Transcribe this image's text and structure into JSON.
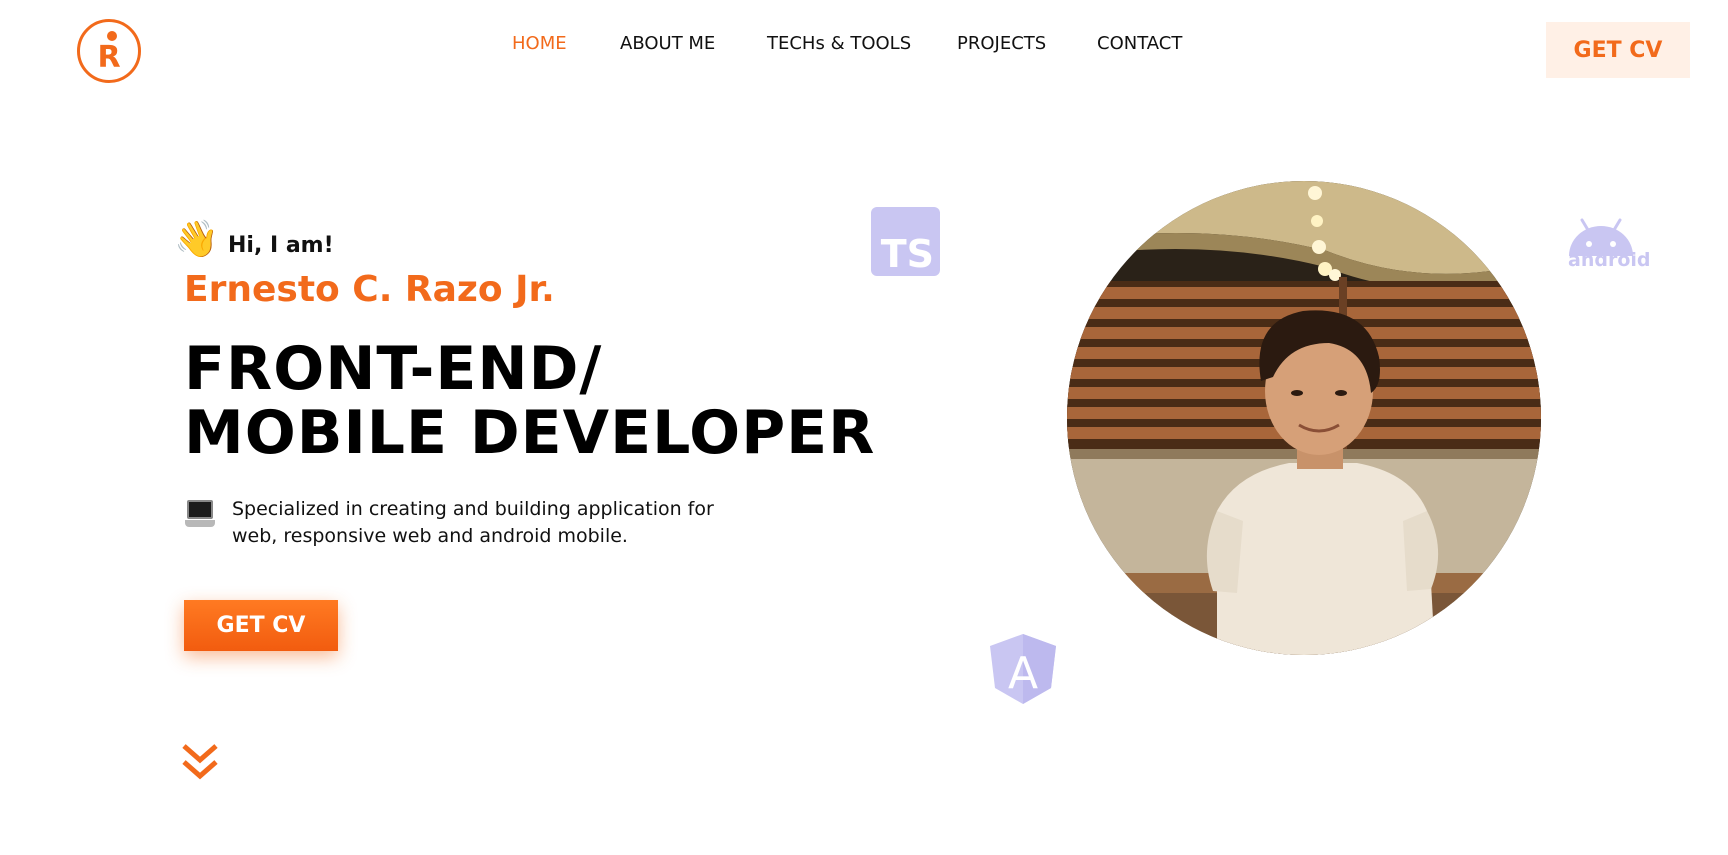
{
  "logo": {
    "letter": "R"
  },
  "nav": {
    "items": [
      {
        "label": "HOME",
        "active": true
      },
      {
        "label": "ABOUT ME",
        "active": false
      },
      {
        "label": "TECHs & TOOLS",
        "active": false
      },
      {
        "label": "PROJECTS",
        "active": false
      },
      {
        "label": "CONTACT",
        "active": false
      }
    ],
    "cta_label": "GET CV"
  },
  "hero": {
    "wave_emoji": "👋",
    "greeting": "Hi, I am!",
    "name": "Ernesto C. Razo Jr.",
    "headline_line1": "FRONT-END/",
    "headline_line2": "MOBILE DEVELOPER",
    "laptop_icon": "laptop-icon",
    "description_line1": "Specialized in creating and building application for",
    "description_line2": "web, responsive web and android mobile.",
    "cta_label": "GET CV",
    "scroll_icon": "chevrons-down-icon"
  },
  "tech_badges": {
    "typescript": "TS",
    "android": "android",
    "angular": "A"
  },
  "colors": {
    "accent": "#f26a1b",
    "accent_light": "#fff0e6",
    "badge_lavender": "#c9c6f2",
    "text": "#111111"
  }
}
